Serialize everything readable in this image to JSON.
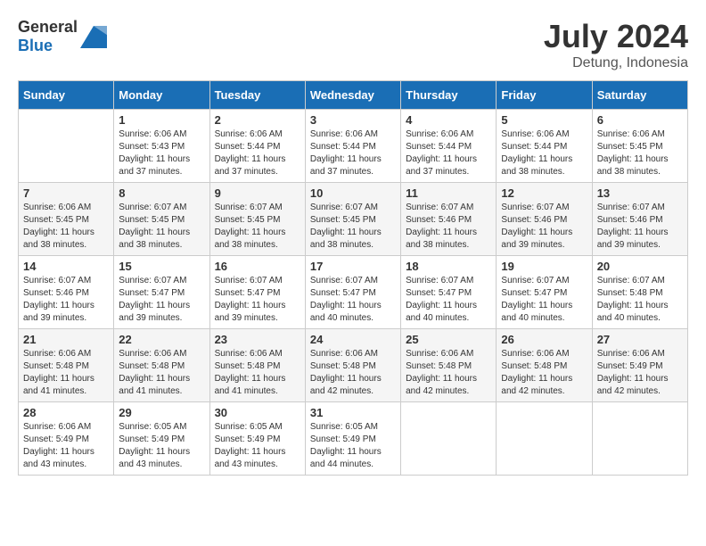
{
  "header": {
    "logo_general": "General",
    "logo_blue": "Blue",
    "month_year": "July 2024",
    "location": "Detung, Indonesia"
  },
  "days_of_week": [
    "Sunday",
    "Monday",
    "Tuesday",
    "Wednesday",
    "Thursday",
    "Friday",
    "Saturday"
  ],
  "weeks": [
    [
      {
        "day": "",
        "sunrise": "",
        "sunset": "",
        "daylight": ""
      },
      {
        "day": "1",
        "sunrise": "Sunrise: 6:06 AM",
        "sunset": "Sunset: 5:43 PM",
        "daylight": "Daylight: 11 hours and 37 minutes."
      },
      {
        "day": "2",
        "sunrise": "Sunrise: 6:06 AM",
        "sunset": "Sunset: 5:44 PM",
        "daylight": "Daylight: 11 hours and 37 minutes."
      },
      {
        "day": "3",
        "sunrise": "Sunrise: 6:06 AM",
        "sunset": "Sunset: 5:44 PM",
        "daylight": "Daylight: 11 hours and 37 minutes."
      },
      {
        "day": "4",
        "sunrise": "Sunrise: 6:06 AM",
        "sunset": "Sunset: 5:44 PM",
        "daylight": "Daylight: 11 hours and 37 minutes."
      },
      {
        "day": "5",
        "sunrise": "Sunrise: 6:06 AM",
        "sunset": "Sunset: 5:44 PM",
        "daylight": "Daylight: 11 hours and 38 minutes."
      },
      {
        "day": "6",
        "sunrise": "Sunrise: 6:06 AM",
        "sunset": "Sunset: 5:45 PM",
        "daylight": "Daylight: 11 hours and 38 minutes."
      }
    ],
    [
      {
        "day": "7",
        "sunrise": "Sunrise: 6:06 AM",
        "sunset": "Sunset: 5:45 PM",
        "daylight": "Daylight: 11 hours and 38 minutes."
      },
      {
        "day": "8",
        "sunrise": "Sunrise: 6:07 AM",
        "sunset": "Sunset: 5:45 PM",
        "daylight": "Daylight: 11 hours and 38 minutes."
      },
      {
        "day": "9",
        "sunrise": "Sunrise: 6:07 AM",
        "sunset": "Sunset: 5:45 PM",
        "daylight": "Daylight: 11 hours and 38 minutes."
      },
      {
        "day": "10",
        "sunrise": "Sunrise: 6:07 AM",
        "sunset": "Sunset: 5:45 PM",
        "daylight": "Daylight: 11 hours and 38 minutes."
      },
      {
        "day": "11",
        "sunrise": "Sunrise: 6:07 AM",
        "sunset": "Sunset: 5:46 PM",
        "daylight": "Daylight: 11 hours and 38 minutes."
      },
      {
        "day": "12",
        "sunrise": "Sunrise: 6:07 AM",
        "sunset": "Sunset: 5:46 PM",
        "daylight": "Daylight: 11 hours and 39 minutes."
      },
      {
        "day": "13",
        "sunrise": "Sunrise: 6:07 AM",
        "sunset": "Sunset: 5:46 PM",
        "daylight": "Daylight: 11 hours and 39 minutes."
      }
    ],
    [
      {
        "day": "14",
        "sunrise": "Sunrise: 6:07 AM",
        "sunset": "Sunset: 5:46 PM",
        "daylight": "Daylight: 11 hours and 39 minutes."
      },
      {
        "day": "15",
        "sunrise": "Sunrise: 6:07 AM",
        "sunset": "Sunset: 5:47 PM",
        "daylight": "Daylight: 11 hours and 39 minutes."
      },
      {
        "day": "16",
        "sunrise": "Sunrise: 6:07 AM",
        "sunset": "Sunset: 5:47 PM",
        "daylight": "Daylight: 11 hours and 39 minutes."
      },
      {
        "day": "17",
        "sunrise": "Sunrise: 6:07 AM",
        "sunset": "Sunset: 5:47 PM",
        "daylight": "Daylight: 11 hours and 40 minutes."
      },
      {
        "day": "18",
        "sunrise": "Sunrise: 6:07 AM",
        "sunset": "Sunset: 5:47 PM",
        "daylight": "Daylight: 11 hours and 40 minutes."
      },
      {
        "day": "19",
        "sunrise": "Sunrise: 6:07 AM",
        "sunset": "Sunset: 5:47 PM",
        "daylight": "Daylight: 11 hours and 40 minutes."
      },
      {
        "day": "20",
        "sunrise": "Sunrise: 6:07 AM",
        "sunset": "Sunset: 5:48 PM",
        "daylight": "Daylight: 11 hours and 40 minutes."
      }
    ],
    [
      {
        "day": "21",
        "sunrise": "Sunrise: 6:06 AM",
        "sunset": "Sunset: 5:48 PM",
        "daylight": "Daylight: 11 hours and 41 minutes."
      },
      {
        "day": "22",
        "sunrise": "Sunrise: 6:06 AM",
        "sunset": "Sunset: 5:48 PM",
        "daylight": "Daylight: 11 hours and 41 minutes."
      },
      {
        "day": "23",
        "sunrise": "Sunrise: 6:06 AM",
        "sunset": "Sunset: 5:48 PM",
        "daylight": "Daylight: 11 hours and 41 minutes."
      },
      {
        "day": "24",
        "sunrise": "Sunrise: 6:06 AM",
        "sunset": "Sunset: 5:48 PM",
        "daylight": "Daylight: 11 hours and 42 minutes."
      },
      {
        "day": "25",
        "sunrise": "Sunrise: 6:06 AM",
        "sunset": "Sunset: 5:48 PM",
        "daylight": "Daylight: 11 hours and 42 minutes."
      },
      {
        "day": "26",
        "sunrise": "Sunrise: 6:06 AM",
        "sunset": "Sunset: 5:48 PM",
        "daylight": "Daylight: 11 hours and 42 minutes."
      },
      {
        "day": "27",
        "sunrise": "Sunrise: 6:06 AM",
        "sunset": "Sunset: 5:49 PM",
        "daylight": "Daylight: 11 hours and 42 minutes."
      }
    ],
    [
      {
        "day": "28",
        "sunrise": "Sunrise: 6:06 AM",
        "sunset": "Sunset: 5:49 PM",
        "daylight": "Daylight: 11 hours and 43 minutes."
      },
      {
        "day": "29",
        "sunrise": "Sunrise: 6:05 AM",
        "sunset": "Sunset: 5:49 PM",
        "daylight": "Daylight: 11 hours and 43 minutes."
      },
      {
        "day": "30",
        "sunrise": "Sunrise: 6:05 AM",
        "sunset": "Sunset: 5:49 PM",
        "daylight": "Daylight: 11 hours and 43 minutes."
      },
      {
        "day": "31",
        "sunrise": "Sunrise: 6:05 AM",
        "sunset": "Sunset: 5:49 PM",
        "daylight": "Daylight: 11 hours and 44 minutes."
      },
      {
        "day": "",
        "sunrise": "",
        "sunset": "",
        "daylight": ""
      },
      {
        "day": "",
        "sunrise": "",
        "sunset": "",
        "daylight": ""
      },
      {
        "day": "",
        "sunrise": "",
        "sunset": "",
        "daylight": ""
      }
    ]
  ]
}
